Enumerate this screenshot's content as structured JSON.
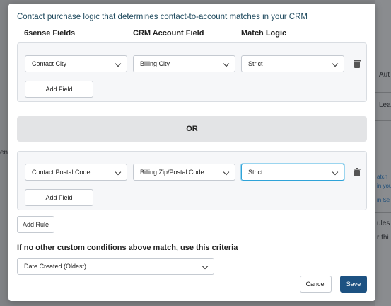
{
  "background": {
    "snippets": [
      "Aut",
      "Lea",
      "ent",
      "atch",
      "in you",
      "in Se",
      "ules",
      "r thi"
    ]
  },
  "modal": {
    "title": "Contact purchase logic that determines contact-to-account matches in your CRM",
    "columns": {
      "sixsense": "6sense Fields",
      "crm": "CRM Account Field",
      "logic": "Match Logic"
    },
    "groups": [
      {
        "sixsense_field": "Contact City",
        "crm_field": "Billing City",
        "match_logic": "Strict",
        "add_field_label": "Add Field"
      },
      {
        "sixsense_field": "Contact Postal Code",
        "crm_field": "Billing Zip/Postal Code",
        "match_logic": "Strict",
        "add_field_label": "Add Field"
      }
    ],
    "or_label": "OR",
    "add_rule_label": "Add Rule",
    "criteria_label": "If no other custom conditions above match, use this criteria",
    "criteria_value": "Date Created (Oldest)",
    "cancel_label": "Cancel",
    "save_label": "Save",
    "colors": {
      "primary": "#1d5282",
      "focus": "#2fa3d8",
      "title": "#1f4a5e"
    }
  }
}
